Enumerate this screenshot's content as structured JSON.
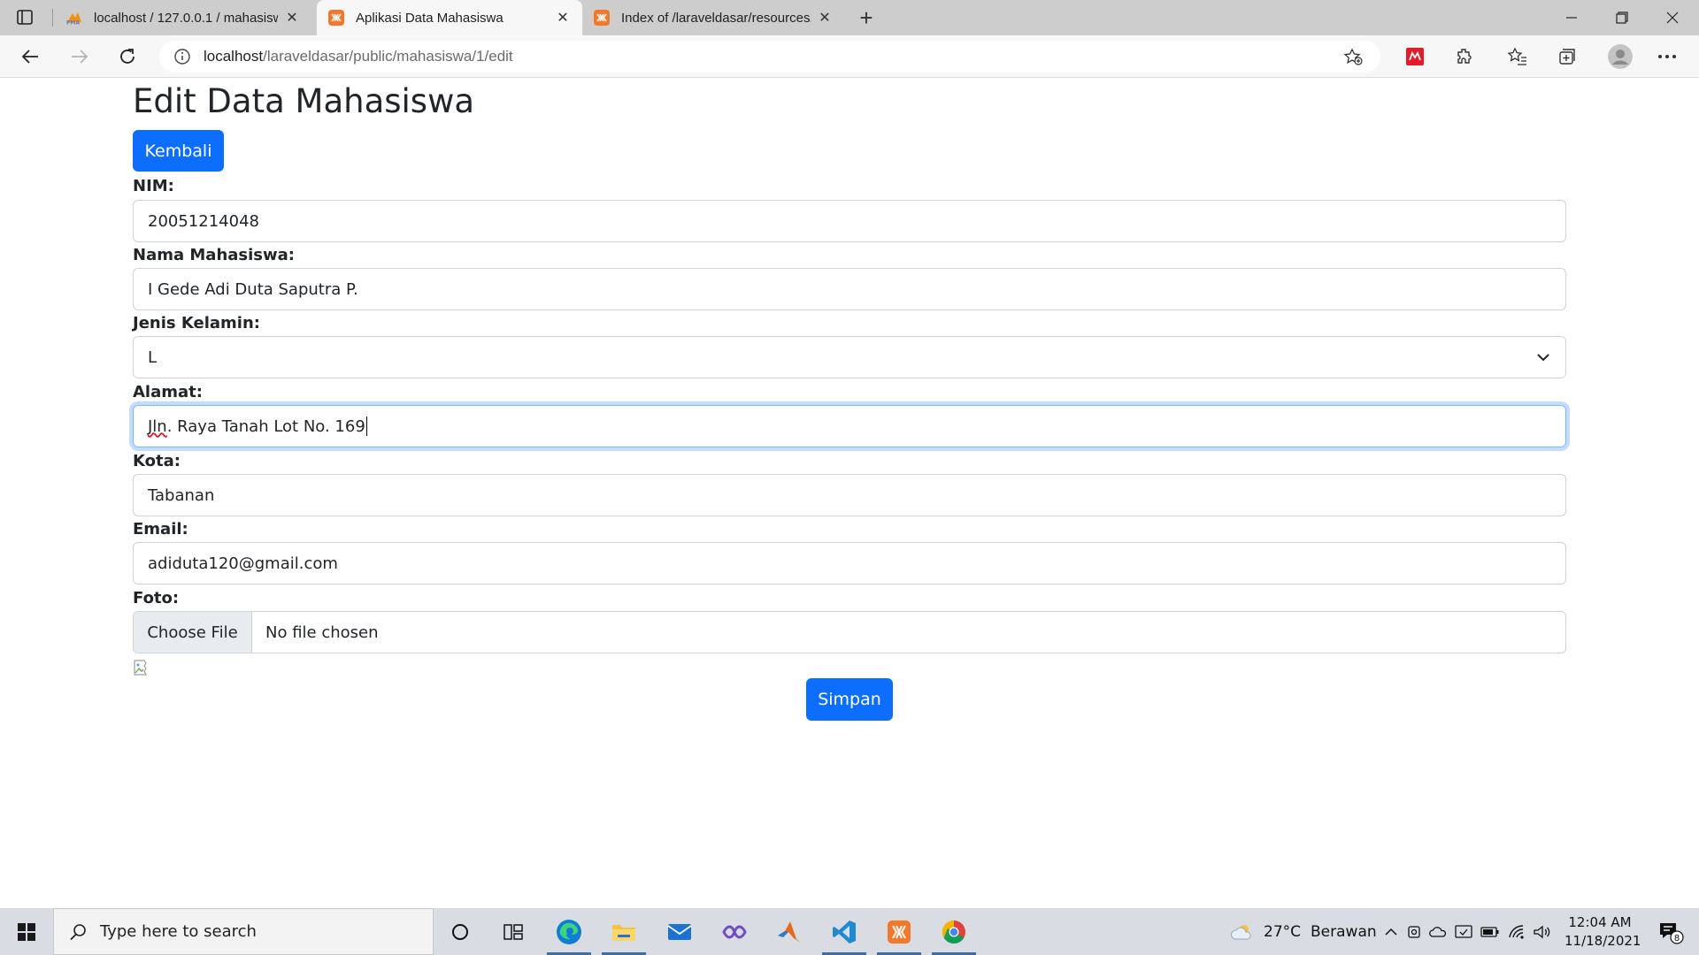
{
  "browser": {
    "tabs": [
      {
        "title": "localhost / 127.0.0.1 / mahasiswa",
        "favicon": "phpmyadmin-icon",
        "active": false
      },
      {
        "title": "Aplikasi Data Mahasiswa",
        "favicon": "laravel-icon",
        "active": true
      },
      {
        "title": "Index of /laraveldasar/resources/",
        "favicon": "laravel-icon",
        "active": false
      }
    ],
    "url_host": "localhost",
    "url_path": "/laraveldasar/public/mahasiswa/1/edit"
  },
  "page": {
    "title": "Edit Data Mahasiswa",
    "back_button": "Kembali",
    "save_button": "Simpan",
    "fields": {
      "nim": {
        "label": "NIM:",
        "value": "20051214048"
      },
      "nama": {
        "label": "Nama Mahasiswa:",
        "value": "I Gede Adi Duta Saputra P."
      },
      "jenis_kelamin": {
        "label": "Jenis Kelamin:",
        "value": "L"
      },
      "alamat": {
        "label": "Alamat:",
        "value_prefix": "Jln",
        "value_rest": ". Raya Tanah Lot No. 169"
      },
      "kota": {
        "label": "Kota:",
        "value": "Tabanan"
      },
      "email": {
        "label": "Email:",
        "value": "adiduta120@gmail.com"
      },
      "foto": {
        "label": "Foto:",
        "button": "Choose File",
        "status": "No file chosen"
      }
    }
  },
  "taskbar": {
    "search_placeholder": "Type here to search",
    "weather_temp": "27°C",
    "weather_desc": "Berawan",
    "time": "12:04 AM",
    "date": "11/18/2021",
    "notification_count": "8"
  },
  "colors": {
    "primary": "#0d6efd",
    "focus_border": "#86b7fe",
    "tab_bar": "#cdcdcd",
    "taskbar": "#d9dde3"
  }
}
